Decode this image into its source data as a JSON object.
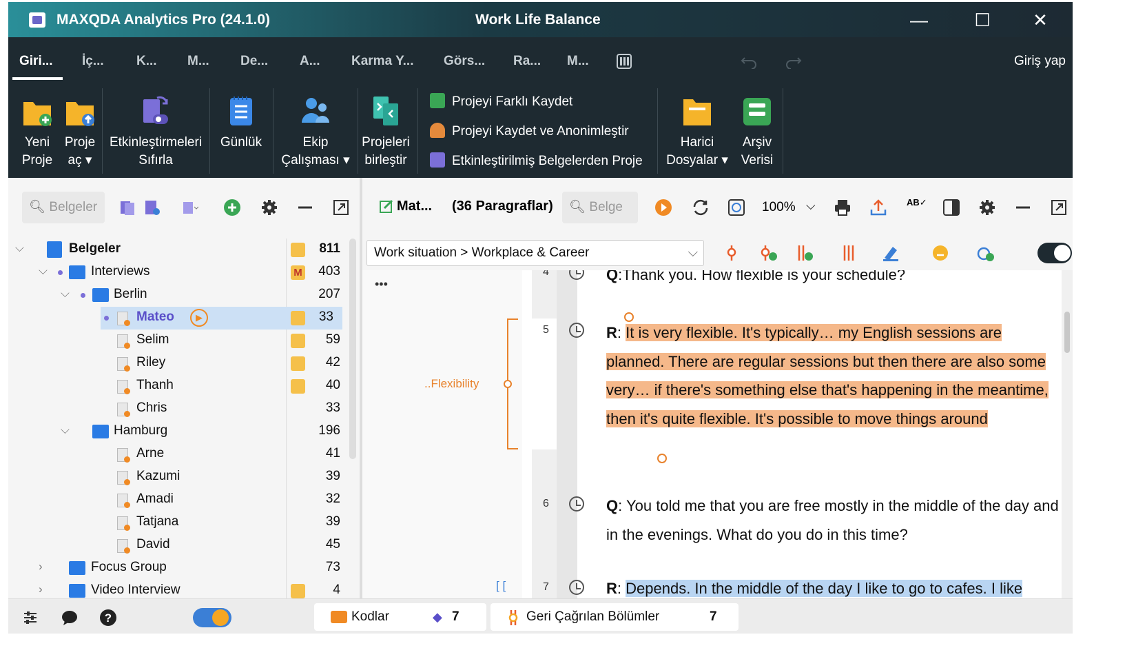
{
  "window": {
    "app_title": "MAXQDA Analytics Pro (24.1.0)",
    "document_title": "Work Life Balance",
    "minimize": "—",
    "maximize": "☐",
    "close": "✕"
  },
  "menu": {
    "tabs": [
      "Giri...",
      "İç...",
      "K...",
      "M...",
      "De...",
      "A...",
      "Karma Y...",
      "Görs...",
      "Ra...",
      "M..."
    ],
    "login": "Giriş yap"
  },
  "ribbon": {
    "new_project": [
      "Yeni",
      "Proje"
    ],
    "open_project": [
      "Proje",
      "aç ▾"
    ],
    "reset_activations": [
      "Etkinleştirmeleri",
      "Sıfırla"
    ],
    "logbook": "Günlük",
    "teamwork": [
      "Ekip",
      "Çalışması ▾"
    ],
    "merge_projects": [
      "Projeleri",
      "birleştir"
    ],
    "save_as": "Projeyi Farklı Kaydet",
    "save_anonymize": "Projeyi Kaydet ve Anonimleştir",
    "from_activated": "Etkinleştirilmiş Belgelerden Proje",
    "external_files": [
      "Harici",
      "Dosyalar ▾"
    ],
    "archive_data": [
      "Arşiv",
      "Verisi"
    ]
  },
  "documents_panel": {
    "search_placeholder": "Belgeler",
    "tree": [
      {
        "label": "Belgeler",
        "count": "811"
      },
      {
        "label": "Interviews",
        "count": "403"
      },
      {
        "label": "Berlin",
        "count": "207"
      },
      {
        "label": "Mateo",
        "count": "33"
      },
      {
        "label": "Selim",
        "count": "59"
      },
      {
        "label": "Riley",
        "count": "42"
      },
      {
        "label": "Thanh",
        "count": "40"
      },
      {
        "label": "Chris",
        "count": "33"
      },
      {
        "label": "Hamburg",
        "count": "196"
      },
      {
        "label": "Arne",
        "count": "41"
      },
      {
        "label": "Kazumi",
        "count": "39"
      },
      {
        "label": "Amadi",
        "count": "32"
      },
      {
        "label": "Tatjana",
        "count": "39"
      },
      {
        "label": "David",
        "count": "45"
      },
      {
        "label": "Focus Group",
        "count": "73"
      },
      {
        "label": "Video Interview",
        "count": "4"
      }
    ]
  },
  "document_browser": {
    "doc_name": "Mat...",
    "paragraphs": "(36 Paragraflar)",
    "search_placeholder": "Belge",
    "zoom": "100%",
    "code_path": "Work situation > Workplace & Career",
    "coding_label": "..Flexibility",
    "ellipsis": "•••",
    "paragraph_numbers": [
      "4",
      "5",
      "6",
      "7"
    ],
    "p4_speaker": "Q",
    "p4_text": ":Thank you. How flexible is your schedule?",
    "p5_speaker": "R",
    "p5_text": "It is very flexible. It's typically… my English sessions are planned. There are regular sessions but then there are also some very… if there's something else that's happening in the meantime, then it's quite flexible. It's possible to move things around",
    "p6_speaker": "Q",
    "p6_text": ": You told me that you are free mostly in the middle of the day and in the evenings. What do you do in this time?",
    "p7_speaker": "R",
    "p7_text": "Depends. In the middle of the day I like to go to cafes. I like"
  },
  "statusbar": {
    "codes_label": "Kodlar",
    "codes_count": "7",
    "retrieved_label": "Geri Çağrılan Bölümler",
    "retrieved_count": "7"
  },
  "colors": {
    "accent_orange": "#f08a24",
    "highlight_orange": "#f5b88a",
    "folder_blue": "#2a7be4",
    "ribbon_bg": "#1e2a31"
  }
}
